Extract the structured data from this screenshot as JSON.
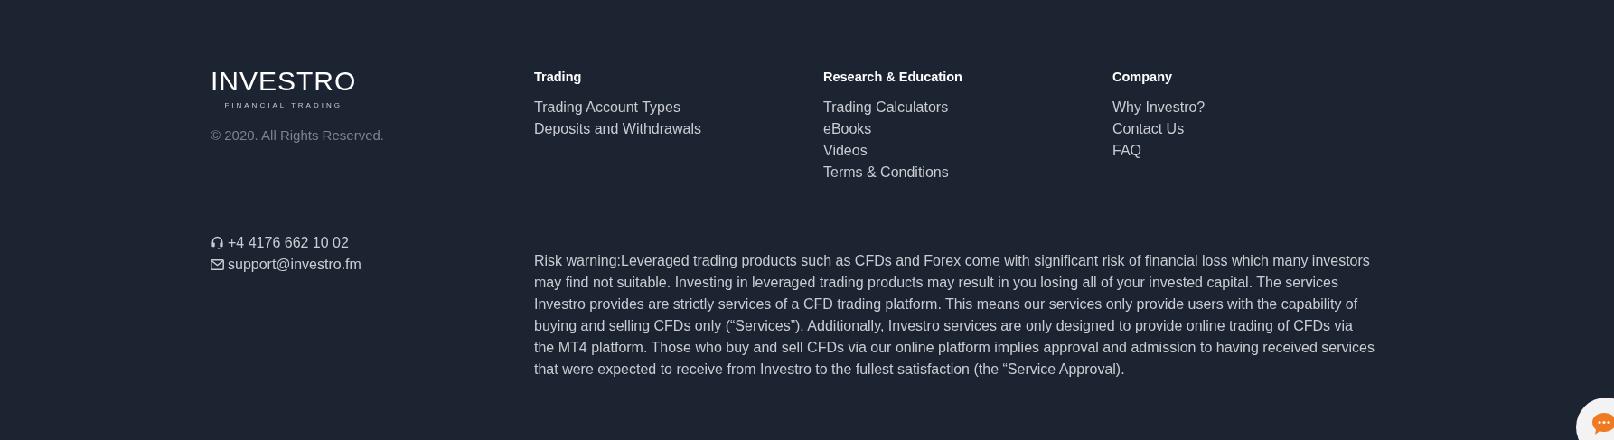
{
  "brand": {
    "name": "INVESTRO",
    "tagline": "FINANCIAL TRADING",
    "copyright": "© 2020. All Rights Reserved."
  },
  "columns": [
    {
      "heading": "Trading",
      "links": [
        "Trading Account Types",
        "Deposits and Withdrawals"
      ]
    },
    {
      "heading": "Research & Education",
      "links": [
        "Trading Calculators",
        "eBooks",
        "Videos",
        "Terms & Conditions"
      ]
    },
    {
      "heading": "Company",
      "links": [
        "Why Investro?",
        "Contact Us",
        "FAQ"
      ]
    }
  ],
  "contacts": [
    {
      "kind": "phone",
      "text": "+4 4176 662 10 02"
    },
    {
      "kind": "email",
      "text": "support@investro.fm"
    }
  ],
  "risk_warning": "Risk warning:Leveraged trading products such as CFDs and Forex come with significant risk of financial loss which many investors may find not suitable. Investing in leveraged trading products may result in you losing all of your invested capital. The services Investro provides are strictly services of a CFD trading platform. This means our services only provide users with the capability of buying and selling CFDs only (“Services”). Additionally, Investro services are only designed to provide online trading of CFDs via the MT4 platform. Those who buy and sell CFDs via our online platform implies approval and admission to having received services that were expected to receive from Investro to the fullest satisfaction (the “Service Approval)."
}
